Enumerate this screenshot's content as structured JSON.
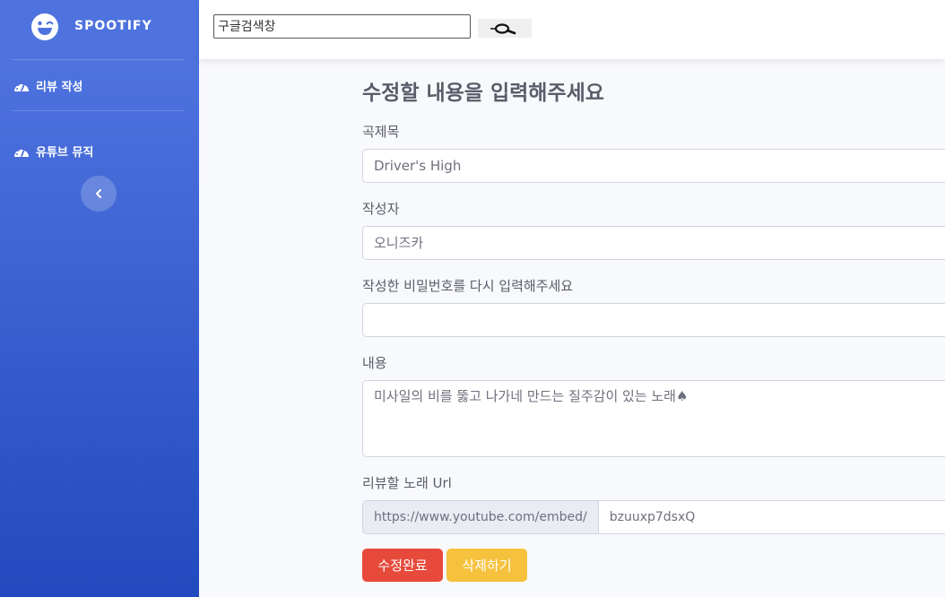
{
  "brand": {
    "name": "SPOOTIFY",
    "icon": "laugh-wink-icon"
  },
  "sidebar": {
    "items": [
      {
        "label": "리뷰 작성",
        "icon": "tachometer-icon"
      },
      {
        "label": "유튜브 뮤직",
        "icon": "tachometer-icon"
      }
    ],
    "toggle_icon": "chevron-left-icon"
  },
  "topbar": {
    "search_value": "구글검색창",
    "search_icon": "magnifier-icon"
  },
  "form": {
    "heading": "수정할 내용을 입력해주세요",
    "title_label": "곡제목",
    "title_value": "Driver's High",
    "author_label": "작성자",
    "author_value": "오니즈카",
    "password_label": "작성한 비밀번호를 다시 입력해주세요",
    "password_value": "",
    "content_label": "내용",
    "content_value": "미사일의 비를 뚫고 나가네 만드는 질주감이 있는 노래♠",
    "url_label": "리뷰할 노래 Url",
    "url_prefix": "https://www.youtube.com/embed/",
    "url_value": "bzuuxp7dsxQ",
    "submit_label": "수정완료",
    "delete_label": "삭제하기"
  },
  "colors": {
    "sidebar_top": "#4e73df",
    "sidebar_bottom": "#224abe",
    "danger": "#e74a3b",
    "warning": "#f6c23e"
  }
}
